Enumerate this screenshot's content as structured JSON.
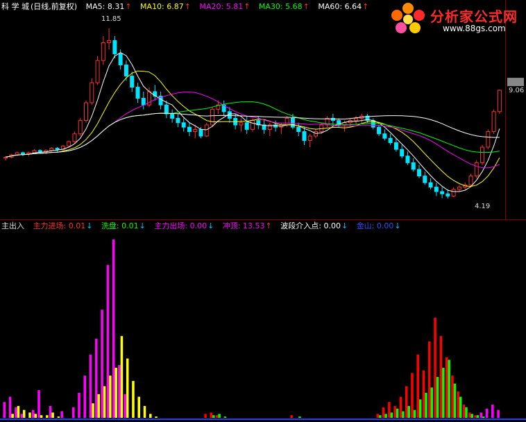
{
  "price_header": {
    "name": "科 学 城",
    "period": "(日线,前复权)",
    "ma5_label": "MA5:",
    "ma5_value": "8.31",
    "ma10_label": "MA10:",
    "ma10_value": "6.87",
    "ma20_label": "MA20:",
    "ma20_value": "5.81",
    "ma30_label": "MA30:",
    "ma30_value": "5.68",
    "ma60_label": "MA60:",
    "ma60_value": "6.64",
    "colors": {
      "ma5": "#ffffff",
      "ma10": "#ffff00",
      "ma20": "#ff00ff",
      "ma30": "#00ff00",
      "ma60": "#ffffff"
    }
  },
  "indicator_header": {
    "name": "主出入",
    "main_in_label": "主力进场:",
    "main_in_value": "0.01",
    "wash_label": "洗盘:",
    "wash_value": "0.01",
    "main_out_label": "主力出场:",
    "main_out_value": "0.00",
    "top_label": "冲顶:",
    "top_value": "13.53",
    "wave_label": "波段介入点:",
    "wave_value": "0.00",
    "gold_label": "金山:",
    "gold_value": "0.00"
  },
  "annotations": {
    "high": "11.85",
    "low": "4.19",
    "last": "9.06"
  },
  "watermark": {
    "title": "分析家公式网",
    "url": "www.88gs.com"
  },
  "chart_data": [
    {
      "type": "candlestick",
      "title": "科 学 城",
      "ylim": [
        3.5,
        12.5
      ],
      "candles": [
        [
          6.0,
          6.1,
          5.9,
          6.05
        ],
        [
          6.05,
          6.2,
          6.0,
          6.15
        ],
        [
          6.15,
          6.3,
          6.1,
          6.25
        ],
        [
          6.25,
          6.3,
          6.1,
          6.2
        ],
        [
          6.2,
          6.3,
          6.1,
          6.25
        ],
        [
          6.25,
          6.4,
          6.2,
          6.35
        ],
        [
          6.35,
          6.4,
          6.2,
          6.3
        ],
        [
          6.3,
          6.4,
          6.2,
          6.35
        ],
        [
          6.35,
          6.5,
          6.3,
          6.45
        ],
        [
          6.45,
          6.5,
          6.3,
          6.4
        ],
        [
          6.4,
          6.6,
          6.35,
          6.55
        ],
        [
          6.55,
          6.8,
          6.5,
          6.75
        ],
        [
          6.75,
          7.2,
          6.7,
          7.1
        ],
        [
          7.1,
          7.8,
          7.0,
          7.7
        ],
        [
          7.7,
          8.6,
          7.6,
          8.5
        ],
        [
          8.5,
          9.6,
          8.4,
          9.4
        ],
        [
          9.4,
          10.6,
          9.3,
          10.4
        ],
        [
          10.4,
          11.5,
          10.2,
          11.2
        ],
        [
          11.2,
          11.85,
          10.9,
          11.3
        ],
        [
          11.3,
          11.5,
          10.5,
          10.7
        ],
        [
          10.7,
          10.9,
          10.0,
          10.2
        ],
        [
          10.2,
          10.4,
          9.5,
          9.7
        ],
        [
          9.7,
          9.9,
          9.0,
          9.2
        ],
        [
          9.2,
          9.4,
          8.5,
          8.7
        ],
        [
          8.7,
          9.0,
          8.2,
          8.4
        ],
        [
          8.4,
          9.2,
          8.3,
          9.0
        ],
        [
          9.0,
          9.3,
          8.6,
          8.8
        ],
        [
          8.8,
          9.0,
          8.2,
          8.4
        ],
        [
          8.4,
          8.6,
          7.8,
          8.0
        ],
        [
          8.0,
          8.2,
          7.6,
          7.8
        ],
        [
          7.8,
          8.0,
          7.4,
          7.6
        ],
        [
          7.6,
          7.8,
          7.2,
          7.4
        ],
        [
          7.4,
          7.6,
          7.0,
          7.2
        ],
        [
          7.2,
          7.5,
          6.9,
          7.3
        ],
        [
          7.3,
          7.4,
          6.9,
          7.0
        ],
        [
          7.0,
          7.6,
          6.95,
          7.5
        ],
        [
          7.5,
          8.3,
          7.4,
          8.2
        ],
        [
          8.2,
          8.6,
          8.0,
          8.4
        ],
        [
          8.4,
          8.6,
          7.9,
          8.1
        ],
        [
          8.1,
          8.3,
          7.6,
          7.8
        ],
        [
          7.8,
          8.0,
          7.3,
          7.5
        ],
        [
          7.5,
          7.8,
          7.2,
          7.6
        ],
        [
          7.6,
          7.9,
          7.1,
          7.3
        ],
        [
          7.3,
          7.8,
          7.2,
          7.7
        ],
        [
          7.7,
          7.9,
          7.3,
          7.5
        ],
        [
          7.5,
          7.7,
          7.1,
          7.3
        ],
        [
          7.3,
          7.6,
          7.0,
          7.5
        ],
        [
          7.5,
          7.7,
          7.2,
          7.4
        ],
        [
          7.4,
          7.6,
          7.1,
          7.5
        ],
        [
          7.5,
          7.9,
          7.4,
          7.8
        ],
        [
          7.8,
          8.0,
          7.3,
          7.4
        ],
        [
          7.4,
          7.6,
          7.0,
          7.2
        ],
        [
          7.2,
          7.4,
          6.6,
          6.8
        ],
        [
          6.8,
          7.1,
          6.5,
          7.0
        ],
        [
          7.0,
          7.3,
          6.9,
          7.2
        ],
        [
          7.2,
          7.6,
          7.1,
          7.5
        ],
        [
          7.5,
          7.9,
          7.4,
          7.8
        ],
        [
          7.8,
          8.0,
          7.5,
          7.7
        ],
        [
          7.7,
          7.8,
          7.4,
          7.5
        ],
        [
          7.5,
          7.7,
          7.2,
          7.6
        ],
        [
          7.6,
          7.8,
          7.4,
          7.7
        ],
        [
          7.7,
          7.9,
          7.5,
          7.8
        ],
        [
          7.8,
          8.0,
          7.6,
          7.9
        ],
        [
          7.9,
          8.0,
          7.6,
          7.7
        ],
        [
          7.7,
          7.8,
          7.3,
          7.4
        ],
        [
          7.4,
          7.5,
          7.0,
          7.1
        ],
        [
          7.1,
          7.3,
          6.8,
          6.9
        ],
        [
          6.9,
          7.1,
          6.6,
          6.7
        ],
        [
          6.7,
          6.9,
          6.3,
          6.4
        ],
        [
          6.4,
          6.6,
          6.0,
          6.1
        ],
        [
          6.1,
          6.3,
          5.7,
          5.8
        ],
        [
          5.8,
          6.0,
          5.4,
          5.5
        ],
        [
          5.5,
          5.7,
          5.1,
          5.2
        ],
        [
          5.2,
          5.4,
          4.8,
          4.9
        ],
        [
          4.9,
          5.1,
          4.6,
          4.7
        ],
        [
          4.7,
          4.9,
          4.3,
          4.5
        ],
        [
          4.5,
          4.7,
          4.2,
          4.4
        ],
        [
          4.4,
          4.6,
          4.19,
          4.3
        ],
        [
          4.3,
          4.7,
          4.25,
          4.6
        ],
        [
          4.6,
          4.8,
          4.5,
          4.7
        ],
        [
          4.7,
          4.9,
          4.6,
          4.8
        ],
        [
          4.8,
          5.3,
          4.7,
          5.2
        ],
        [
          5.2,
          5.9,
          5.1,
          5.8
        ],
        [
          5.8,
          6.6,
          5.7,
          6.5
        ],
        [
          6.5,
          7.3,
          6.4,
          7.2
        ],
        [
          7.2,
          8.2,
          7.1,
          8.1
        ],
        [
          8.1,
          9.1,
          8.0,
          9.06
        ]
      ]
    },
    {
      "type": "bar",
      "title": "主出入",
      "ylim": [
        0,
        14
      ],
      "series": [
        {
          "name": "主力进场",
          "color": "#ff0000"
        },
        {
          "name": "洗盘",
          "color": "#00ff00"
        },
        {
          "name": "主力出场",
          "color": "#ff00ff"
        },
        {
          "name": "冲顶",
          "color": "#ffff00"
        }
      ],
      "bars": [
        [
          0.3,
          0.0,
          1.2,
          0.0
        ],
        [
          0.2,
          0.0,
          1.6,
          0.3
        ],
        [
          0.0,
          0.0,
          0.8,
          0.9
        ],
        [
          0.0,
          0.0,
          0.3,
          0.6
        ],
        [
          0.0,
          0.0,
          0.0,
          0.4
        ],
        [
          0.0,
          0.0,
          0.6,
          0.3
        ],
        [
          0.0,
          0.0,
          2.1,
          0.2
        ],
        [
          0.0,
          0.0,
          0.0,
          0.2
        ],
        [
          0.0,
          0.0,
          0.9,
          0.4
        ],
        [
          0.0,
          0.0,
          0.0,
          0.1
        ],
        [
          0.0,
          0.0,
          0.5,
          0.0
        ],
        [
          0.0,
          0.0,
          0.0,
          0.0
        ],
        [
          0.0,
          0.0,
          0.8,
          0.0
        ],
        [
          0.0,
          0.0,
          1.9,
          0.0
        ],
        [
          0.0,
          0.0,
          3.2,
          0.0
        ],
        [
          0.0,
          0.0,
          4.8,
          1.1
        ],
        [
          0.0,
          0.0,
          6.0,
          1.8
        ],
        [
          0.0,
          0.0,
          8.2,
          2.4
        ],
        [
          0.0,
          0.0,
          11.6,
          3.2
        ],
        [
          0.0,
          0.0,
          13.53,
          3.8
        ],
        [
          0.0,
          0.0,
          4.0,
          6.2
        ],
        [
          0.0,
          0.0,
          1.8,
          4.5
        ],
        [
          0.0,
          0.0,
          0.0,
          2.8
        ],
        [
          0.0,
          0.0,
          0.0,
          1.6
        ],
        [
          0.0,
          0.0,
          0.0,
          0.9
        ],
        [
          0.0,
          0.0,
          0.0,
          0.3
        ],
        [
          0.0,
          0.0,
          0.0,
          0.1
        ],
        [
          0.0,
          0.0,
          0.0,
          0.0
        ],
        [
          0.0,
          0.0,
          0.0,
          0.0
        ],
        [
          0.0,
          0.0,
          0.0,
          0.0
        ],
        [
          0.0,
          0.0,
          0.0,
          0.0
        ],
        [
          0.0,
          0.0,
          0.0,
          0.0
        ],
        [
          0.0,
          0.0,
          0.0,
          0.0
        ],
        [
          0.0,
          0.0,
          0.0,
          0.0
        ],
        [
          0.0,
          0.0,
          0.0,
          0.0
        ],
        [
          0.3,
          0.0,
          0.0,
          0.0
        ],
        [
          0.4,
          0.2,
          0.0,
          0.0
        ],
        [
          0.2,
          0.3,
          0.0,
          0.0
        ],
        [
          0.0,
          0.1,
          0.0,
          0.0
        ],
        [
          0.0,
          0.0,
          0.0,
          0.0
        ],
        [
          0.0,
          0.0,
          0.0,
          0.0
        ],
        [
          0.0,
          0.0,
          0.0,
          0.0
        ],
        [
          0.0,
          0.0,
          0.0,
          0.0
        ],
        [
          0.0,
          0.0,
          0.0,
          0.0
        ],
        [
          0.0,
          0.0,
          0.0,
          0.0
        ],
        [
          0.0,
          0.0,
          0.0,
          0.0
        ],
        [
          0.0,
          0.0,
          0.0,
          0.0
        ],
        [
          0.0,
          0.0,
          0.0,
          0.0
        ],
        [
          0.0,
          0.0,
          0.0,
          0.0
        ],
        [
          0.0,
          0.0,
          0.0,
          0.0
        ],
        [
          0.2,
          0.0,
          0.0,
          0.0
        ],
        [
          0.0,
          0.1,
          0.0,
          0.0
        ],
        [
          0.0,
          0.0,
          0.0,
          0.0
        ],
        [
          0.0,
          0.0,
          0.0,
          0.0
        ],
        [
          0.0,
          0.0,
          0.0,
          0.0
        ],
        [
          0.0,
          0.0,
          0.0,
          0.0
        ],
        [
          0.0,
          0.0,
          0.0,
          0.0
        ],
        [
          0.0,
          0.0,
          0.0,
          0.0
        ],
        [
          0.0,
          0.0,
          0.0,
          0.0
        ],
        [
          0.0,
          0.0,
          0.0,
          0.0
        ],
        [
          0.0,
          0.0,
          0.0,
          0.0
        ],
        [
          0.0,
          0.0,
          0.0,
          0.0
        ],
        [
          0.0,
          0.0,
          0.0,
          0.0
        ],
        [
          0.0,
          0.0,
          0.0,
          0.0
        ],
        [
          0.0,
          0.0,
          0.0,
          0.0
        ],
        [
          0.3,
          0.2,
          0.0,
          0.0
        ],
        [
          0.8,
          0.3,
          0.0,
          0.0
        ],
        [
          1.2,
          0.4,
          0.0,
          0.0
        ],
        [
          0.9,
          0.7,
          0.0,
          0.0
        ],
        [
          1.6,
          0.5,
          0.0,
          0.0
        ],
        [
          2.4,
          0.9,
          0.0,
          0.0
        ],
        [
          3.4,
          0.6,
          0.0,
          0.0
        ],
        [
          4.8,
          1.4,
          0.0,
          0.0
        ],
        [
          3.6,
          1.9,
          0.0,
          0.0
        ],
        [
          5.8,
          2.3,
          0.0,
          0.0
        ],
        [
          7.6,
          3.1,
          0.0,
          0.0
        ],
        [
          6.2,
          3.8,
          0.0,
          0.0
        ],
        [
          4.6,
          4.4,
          0.0,
          0.0
        ],
        [
          3.2,
          2.6,
          0.0,
          0.0
        ],
        [
          2.0,
          1.6,
          0.0,
          0.0
        ],
        [
          1.0,
          0.8,
          0.0,
          0.0
        ],
        [
          0.4,
          0.3,
          0.0,
          0.0
        ],
        [
          0.2,
          0.2,
          0.0,
          0.0
        ],
        [
          0.0,
          0.1,
          0.4,
          0.0
        ],
        [
          0.0,
          0.0,
          0.7,
          0.0
        ],
        [
          0.0,
          0.0,
          1.0,
          0.0
        ],
        [
          0.0,
          0.0,
          0.6,
          0.0
        ]
      ]
    }
  ]
}
